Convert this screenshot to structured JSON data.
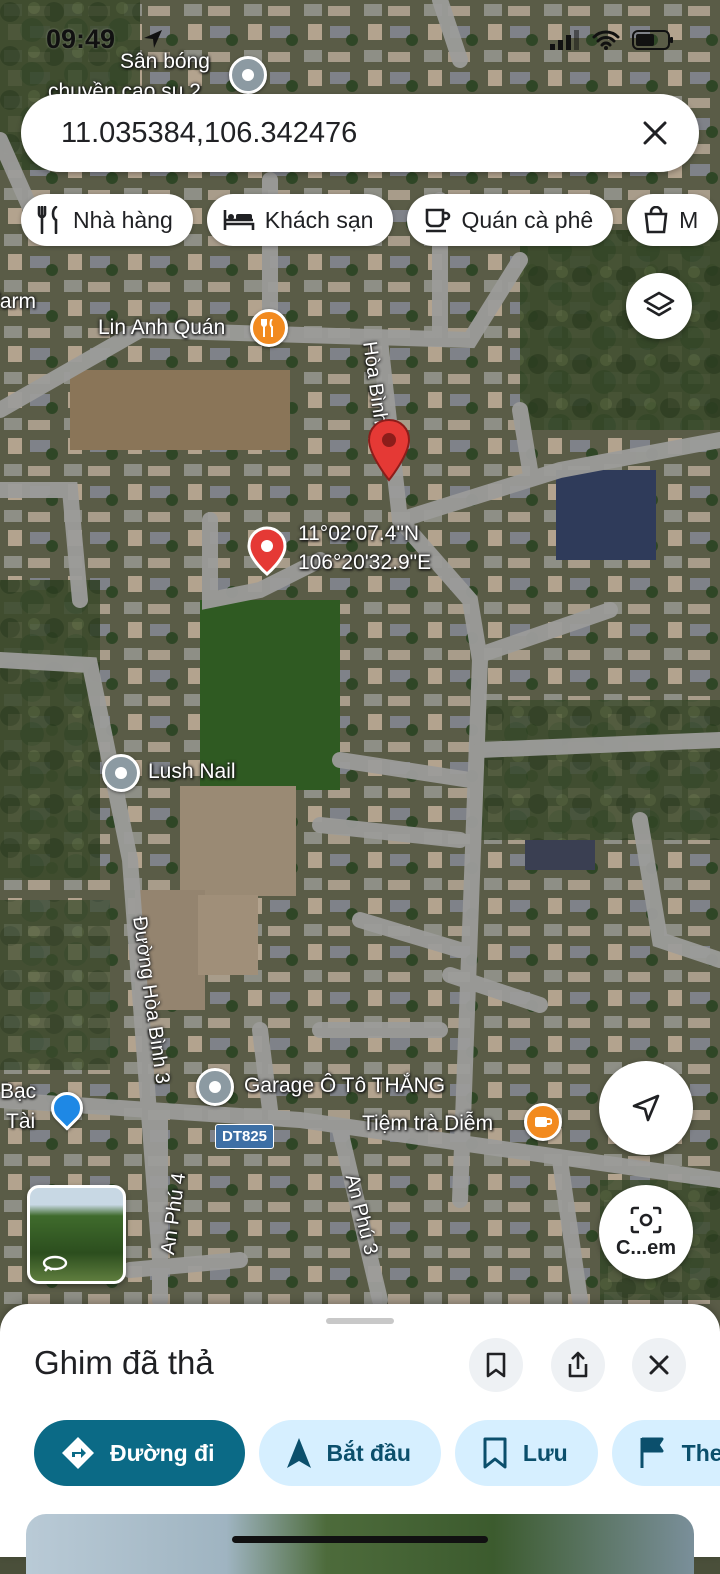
{
  "status_bar": {
    "time": "09:49"
  },
  "search": {
    "query": "11.035384,106.342476"
  },
  "chips": [
    {
      "label": "Nhà hàng",
      "icon": "restaurant-icon"
    },
    {
      "label": "Khách sạn",
      "icon": "hotel-icon"
    },
    {
      "label": "Quán cà phê",
      "icon": "coffee-icon"
    },
    {
      "label": "M",
      "icon": "shopping-icon"
    }
  ],
  "map": {
    "labels": {
      "san_bong_1": "Sân bóng",
      "san_bong_2": "chuyền cao su 2",
      "farm": "farm",
      "lin_anh": "Lin Anh Quán",
      "hoa_binh": "Hòa Bình",
      "coord_lat": "11°02'07.4\"N",
      "coord_lng": "106°20'32.9\"E",
      "lush_nail": "Lush Nail",
      "duong_hoa_binh_3": "Đường Hòa Bình 3",
      "bac": "Bạc",
      "tai": "Tài",
      "garage": "Garage Ô Tô THẮNG",
      "tiem_tra": "Tiệm trà Diễm",
      "route_shield": "DT825",
      "an_phu_4": "An Phú 4",
      "an_phu_3": "An Phú 3"
    },
    "lens_label": "C...em"
  },
  "sheet": {
    "title": "Ghim đã thả",
    "actions": [
      {
        "label": "Đường đi",
        "icon": "directions-icon"
      },
      {
        "label": "Bắt đầu",
        "icon": "navigation-arrow-icon"
      },
      {
        "label": "Lưu",
        "icon": "bookmark-icon"
      },
      {
        "label": "The",
        "icon": "flag-icon"
      }
    ]
  }
}
